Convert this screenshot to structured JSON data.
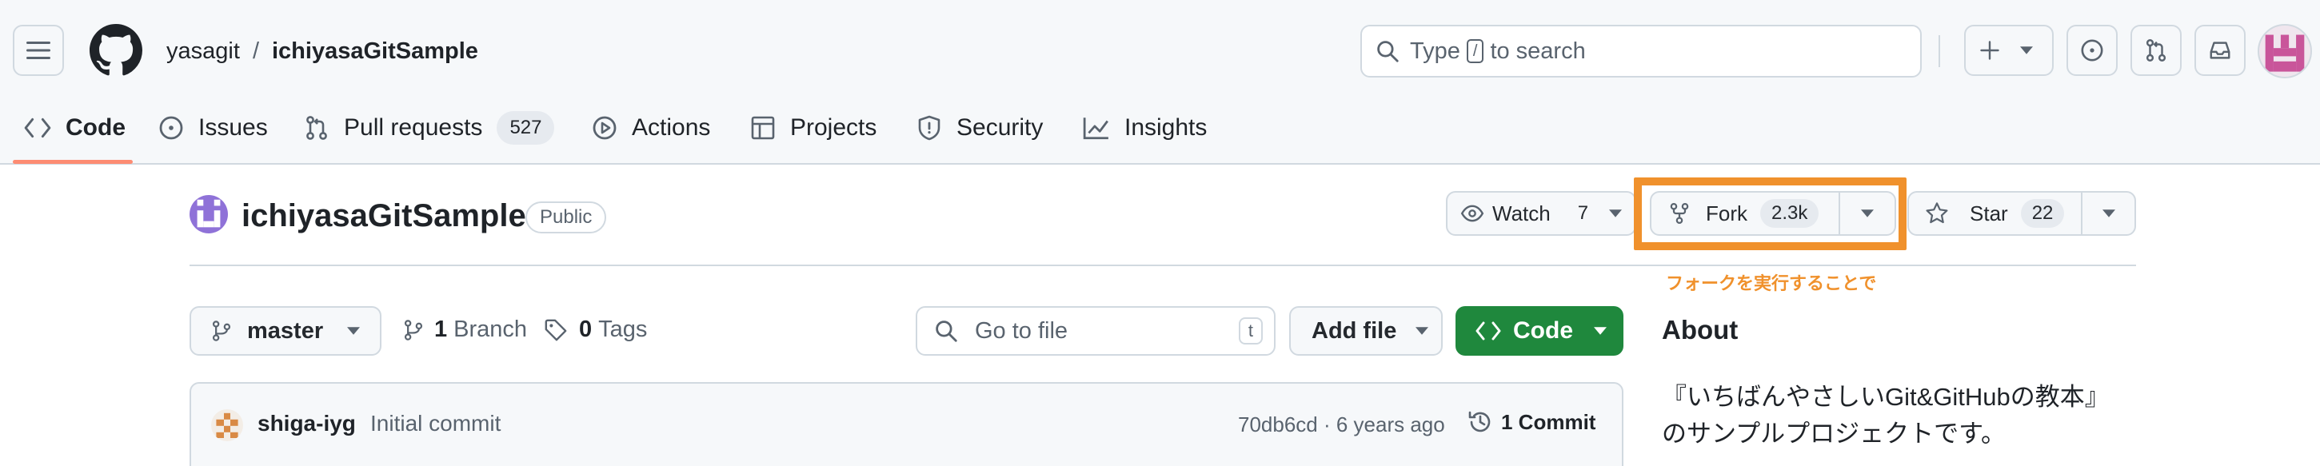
{
  "header": {
    "owner": "yasagit",
    "separator": "/",
    "repo": "ichiyasaGitSample",
    "search_text": "Type",
    "search_key": "/",
    "search_suffix": "to search"
  },
  "tabs": [
    {
      "label": "Code",
      "icon": "code-icon"
    },
    {
      "label": "Issues",
      "icon": "issue-icon"
    },
    {
      "label": "Pull requests",
      "icon": "pull-request-icon",
      "count": "527"
    },
    {
      "label": "Actions",
      "icon": "play-icon"
    },
    {
      "label": "Projects",
      "icon": "table-icon"
    },
    {
      "label": "Security",
      "icon": "shield-icon"
    },
    {
      "label": "Insights",
      "icon": "graph-icon"
    }
  ],
  "repo_header": {
    "title": "ichiyasaGitSample",
    "visibility": "Public",
    "watch_label": "Watch",
    "watch_count": "7",
    "fork_label": "Fork",
    "fork_count": "2.3k",
    "star_label": "Star",
    "star_count": "22"
  },
  "annotation": {
    "text": "フォークを実行することで",
    "color": "#f0912c"
  },
  "file_bar": {
    "branch": "master",
    "branches_count": "1",
    "branches_label": "Branch",
    "tags_count": "0",
    "tags_label": "Tags",
    "go_to_file": "Go to file",
    "go_to_file_key": "t",
    "add_file": "Add file",
    "code_button": "Code"
  },
  "commit": {
    "author": "shiga-iyg",
    "message": "Initial commit",
    "meta": "70db6cd · 6 years ago",
    "count_label": "1 Commit"
  },
  "about": {
    "title": "About",
    "description": "『いちばんやさしいGit&GitHubの教本』のサンプルプロジェクトです。"
  },
  "colors": {
    "accent_green": "#1f883d",
    "tab_underline": "#fd8c73",
    "highlight": "#f0912c"
  }
}
